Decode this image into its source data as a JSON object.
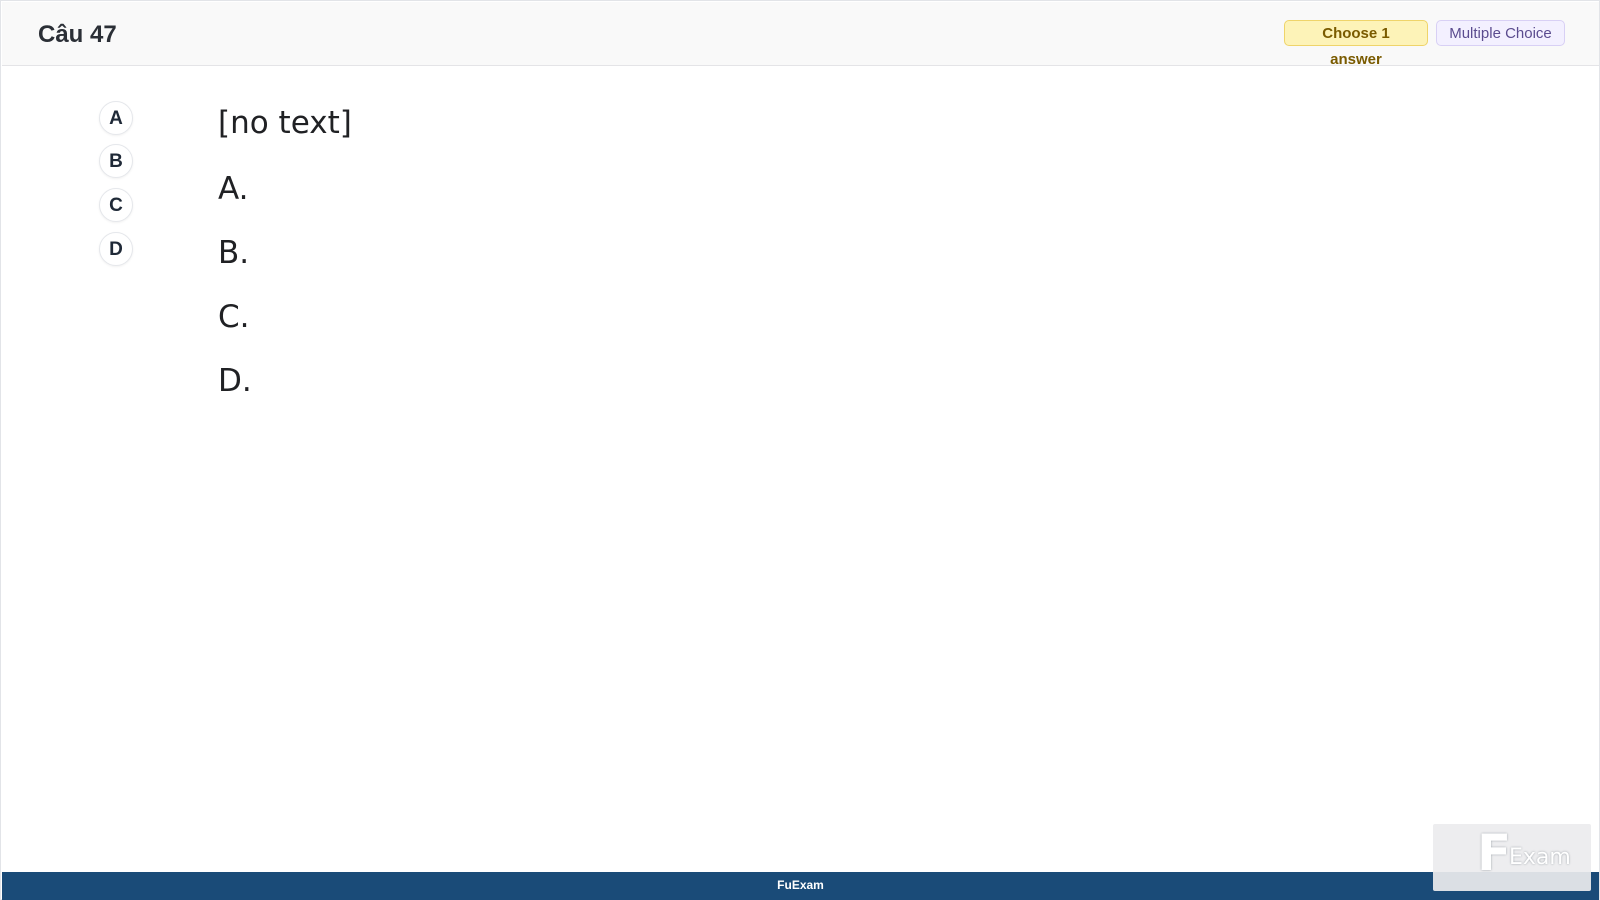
{
  "header": {
    "question_title": "Câu 47",
    "badge_choose": "Choose 1 answer",
    "badge_type": "Multiple Choice"
  },
  "options": [
    "A",
    "B",
    "C",
    "D"
  ],
  "question": {
    "text": "[no text]",
    "answers": [
      "A.",
      "B.",
      "C.",
      "D."
    ]
  },
  "footer": {
    "brand": "FuExam"
  },
  "watermark": {
    "logo_letter": "F",
    "logo_word": "Exam"
  },
  "colors": {
    "footer_bg": "#1a4b78",
    "badge_choose_bg": "#fdf3b8",
    "badge_type_bg": "#f3f0ff"
  }
}
